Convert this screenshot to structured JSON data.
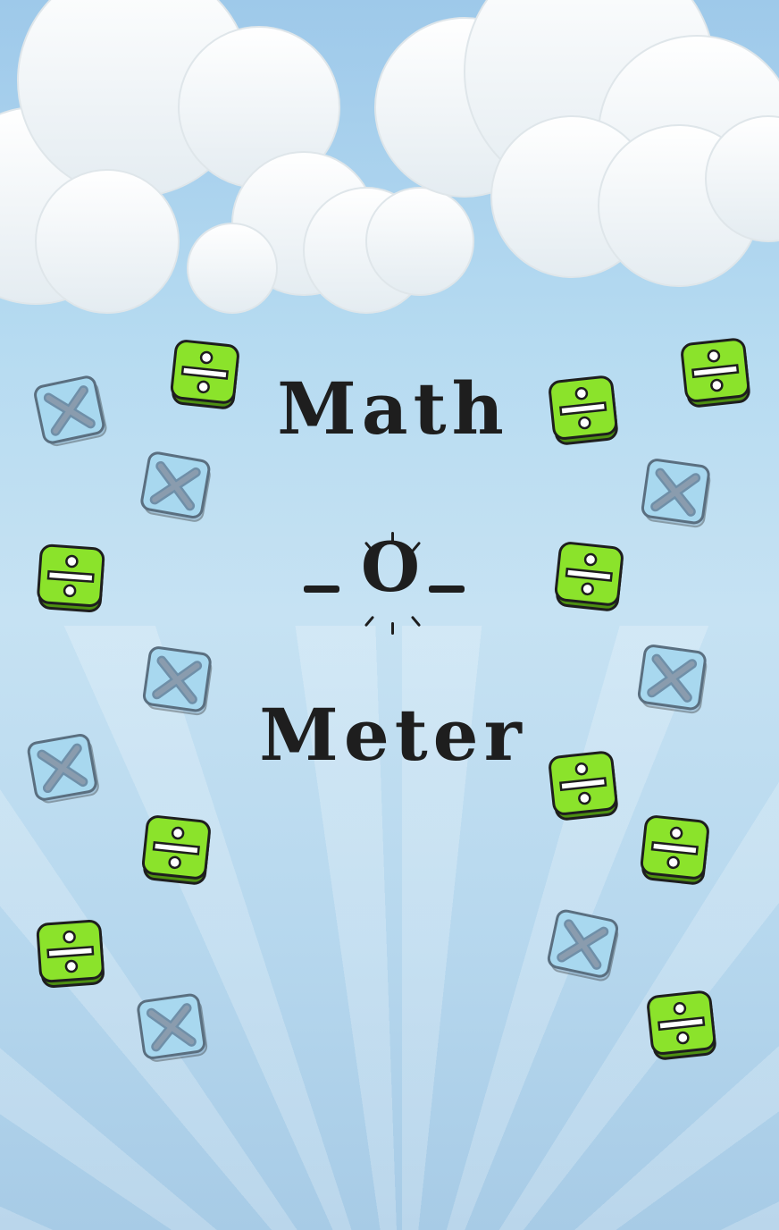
{
  "title": {
    "line1": "Math",
    "line2": "O",
    "line3": "Meter"
  },
  "tiles": {
    "divide_icon": "divide-icon",
    "multiply_icon": "multiply-icon",
    "colors": {
      "divide_fill": "#8be32b",
      "divide_dark": "#4d8f12",
      "multiply_fill": "#a8d8ef",
      "multiply_dark": "#6f8fa8",
      "outline": "#1e1e1e"
    }
  }
}
